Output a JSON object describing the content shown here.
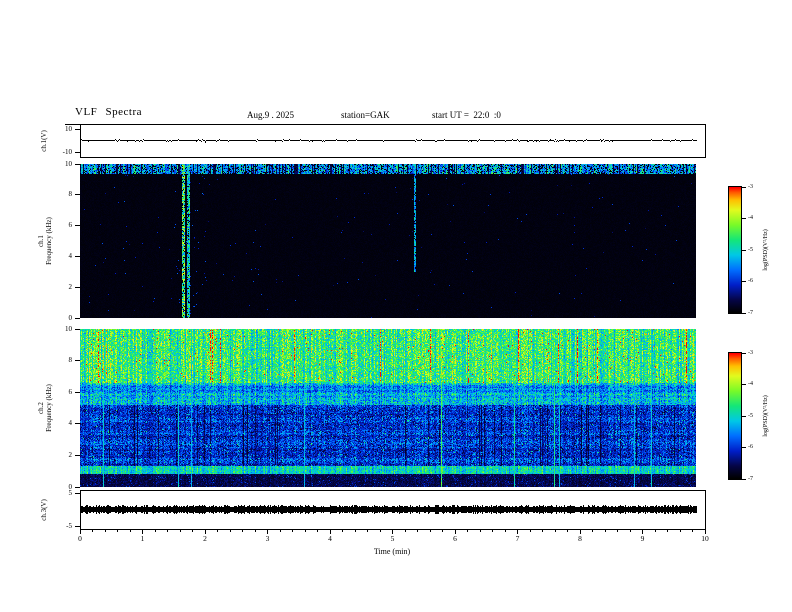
{
  "header": {
    "title": "VLF Spectra",
    "date": "Aug.9 . 2025",
    "station": "station=GAK",
    "start_ut": "start UT =  22:0  :0"
  },
  "xaxis": {
    "label": "Time (min)",
    "ticks": [
      "0",
      "1",
      "2",
      "3",
      "4",
      "5",
      "6",
      "7",
      "8",
      "9",
      "10"
    ]
  },
  "panels": {
    "ch1v": {
      "label": "ch.1(V)",
      "yticks": [
        "10",
        "-10"
      ]
    },
    "ch1spec": {
      "label_line1": "ch.1",
      "label_line2": "Frequency (kHz)",
      "yticks": [
        "10",
        "8",
        "6",
        "4",
        "2",
        "0"
      ]
    },
    "ch2spec": {
      "label_line1": "ch.2",
      "label_line2": "Frequency (kHz)",
      "yticks": [
        "10",
        "8",
        "6",
        "4",
        "2",
        "0"
      ]
    },
    "ch3v": {
      "label": "ch.3(V)",
      "yticks": [
        "5",
        "-5"
      ]
    }
  },
  "colorbar": {
    "label": "log(PSD)(V²/Hz)",
    "ticks": [
      "-3",
      "-4",
      "-5",
      "-6",
      "-7"
    ]
  },
  "colors": {
    "background": "#ffffff",
    "frame": "#000000",
    "spec_background": "#000000"
  },
  "chart_data": [
    {
      "type": "line",
      "panel": "ch.1 voltage",
      "ylabel": "ch.1(V)",
      "ylim": [
        -10,
        10
      ],
      "x_minutes": [
        0,
        9.85
      ],
      "series": [
        {
          "name": "ch.1(V)",
          "summary": "nearly flat low-amplitude trace just above mid-panel for the full record"
        }
      ]
    },
    {
      "type": "heatmap",
      "panel": "ch.1 spectrogram",
      "ylabel": "Frequency (kHz)",
      "ylim": [
        0,
        10
      ],
      "xlim_minutes": [
        0,
        9.85
      ],
      "zlabel": "log(PSD)(V²/Hz)",
      "zlim": [
        -7,
        -3
      ],
      "colormap": "black-blue-cyan-green-yellow-red",
      "background_level": -7,
      "features": [
        {
          "kind": "band",
          "freq_khz": [
            9.4,
            10.0
          ],
          "mean_level": -5.2,
          "time_min": null,
          "note": "persistent speckled emission band at top edge"
        },
        {
          "kind": "vertical-transient",
          "time_min": 1.65,
          "freq_khz": [
            0,
            10
          ],
          "mean_level": -4.6,
          "note": "bright full-height burst"
        },
        {
          "kind": "vertical-transient",
          "time_min": 1.73,
          "freq_khz": [
            0,
            10
          ],
          "mean_level": -5.0,
          "note": "second fainter burst"
        },
        {
          "kind": "vertical-transient",
          "time_min": 5.35,
          "freq_khz": [
            3,
            10
          ],
          "mean_level": -5.4,
          "note": "faint upper-half burst"
        }
      ]
    },
    {
      "type": "heatmap",
      "panel": "ch.2 spectrogram",
      "ylabel": "Frequency (kHz)",
      "ylim": [
        0,
        10
      ],
      "xlim_minutes": [
        0,
        9.85
      ],
      "zlabel": "log(PSD)(V²/Hz)",
      "zlim": [
        -7,
        -3
      ],
      "colormap": "black-blue-cyan-green-yellow-red",
      "bands": [
        {
          "freq_khz": [
            6.6,
            10.0
          ],
          "mean_level": -4.6,
          "texture": "bursty",
          "note": "strong broadband noise, green-yellow with occasional red bursts"
        },
        {
          "freq_khz": [
            5.2,
            6.6
          ],
          "mean_level": -5.4,
          "texture": "mixed",
          "note": "transition band, blue-green"
        },
        {
          "freq_khz": [
            1.35,
            5.2
          ],
          "mean_level": -6.0,
          "texture": "patchy",
          "note": "blue with dark patches and vertical striations"
        },
        {
          "freq_khz": [
            0.85,
            1.35
          ],
          "mean_level": -5.0,
          "texture": "band",
          "note": "green emission band near 1 kHz"
        },
        {
          "freq_khz": [
            0.0,
            0.85
          ],
          "mean_level": -6.6,
          "texture": "dark",
          "note": "weak, mostly black with blue speckle"
        }
      ]
    },
    {
      "type": "line",
      "panel": "ch.3 voltage",
      "ylabel": "ch.3(V)",
      "ylim": [
        -5,
        5
      ],
      "x_minutes": [
        0,
        9.85
      ],
      "series": [
        {
          "name": "ch.3(V)",
          "summary": "dense saturated trace forming a thick black band around 0 V for the full record"
        }
      ]
    }
  ]
}
